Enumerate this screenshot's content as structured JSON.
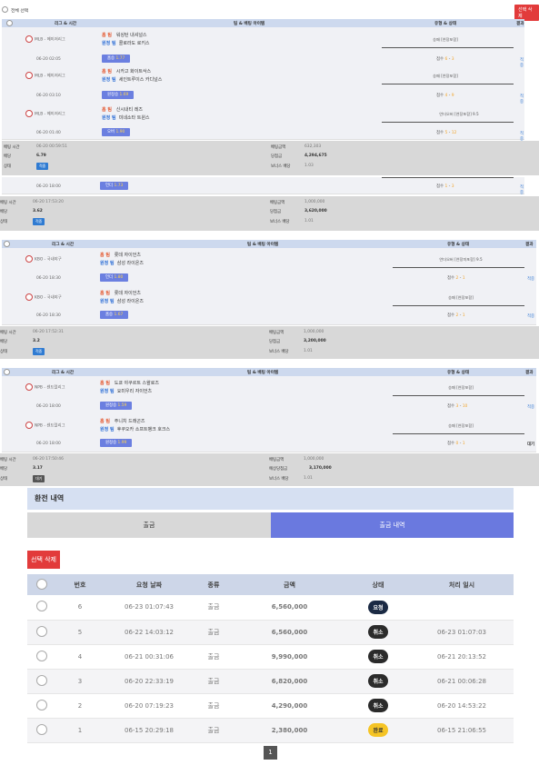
{
  "top": {
    "select_all": "전체 선택",
    "delete_selected": "선택 삭제"
  },
  "bet_header": {
    "league_time": "리그 & 시간",
    "team_bet": "팀 & 배팅 아이템",
    "type_state": "유형 & 상태",
    "result": "결과"
  },
  "summary_labels": {
    "bet_time": "배팅 시간",
    "odds": "배당",
    "state": "상태",
    "bet_amount": "배팅금액",
    "win_amount": "당첨금",
    "bonus_odds": "보너스 배당",
    "expected_win": "예상당첨금"
  },
  "team_tags": {
    "home": "홈 팀",
    "away": "원정 팀"
  },
  "bets": [
    {
      "matches": [
        {
          "league": "MLB - 메이저리그",
          "time": "06-20 02:05",
          "home": "워싱턴 내셔널스",
          "away": "콜로라도 로키스",
          "pick": "홈승",
          "odds": "1.77",
          "type": "승패 [연장포함]",
          "score_label": "점수",
          "score_home": "6",
          "score_away": "3",
          "result": "적중"
        },
        {
          "league": "MLB - 메이저리그",
          "time": "06-20 03:10",
          "home": "시카고 화이트삭스",
          "away": "세인트루이스 카디널스",
          "pick": "원정승",
          "odds": "1.69",
          "type": "승패 [연장포함]",
          "score_label": "점수",
          "score_home": "4",
          "score_away": "9",
          "result": "적중"
        },
        {
          "league": "MLB - 메이저리그",
          "time": "06-20 01:40",
          "home": "신시내티 레즈",
          "away": "미네소타 트윈스",
          "pick": "오버",
          "odds": "1.90",
          "type": "언더오버 [연장포함] 9.5",
          "score_label": "점수",
          "score_home": "5",
          "score_away": "12",
          "result": "적중"
        }
      ],
      "bet_time": "06-20 00:59:51",
      "odds": "6.79",
      "state": "적중",
      "bet_amount": "632,303",
      "win_amount": "4,294,675",
      "bonus_odds": "1.03"
    },
    {
      "matches": [
        {
          "league": "",
          "time": "06-20 18:00",
          "home": "",
          "away": "",
          "pick": "언더",
          "odds": "1.73",
          "type": "",
          "score_label": "점수",
          "score_home": "1",
          "score_away": "3",
          "result": "적중"
        }
      ],
      "bet_time": "06-20 17:53:20",
      "odds": "3.62",
      "state": "적중",
      "bet_amount": "1,000,000",
      "win_amount": "3,620,000",
      "bonus_odds": "1.01"
    },
    {
      "matches": [
        {
          "league": "KBO - 국내야구",
          "time": "06-20 18:30",
          "home": "롯데 자이언츠",
          "away": "삼성 라이온즈",
          "pick": "언더",
          "odds": "1.80",
          "type": "언더오버 [연장미포함] 9.5",
          "score_label": "점수",
          "score_home": "2",
          "score_away": "1",
          "result": "적중"
        },
        {
          "league": "KBO - 국내야구",
          "time": "06-20 18:30",
          "home": "롯데 자이언츠",
          "away": "삼성 라이온즈",
          "pick": "홈승",
          "odds": "1.67",
          "type": "승패 [연장포함]",
          "score_label": "점수",
          "score_home": "2",
          "score_away": "1",
          "result": "적중"
        }
      ],
      "bet_time": "06-20 17:52:31",
      "odds": "3.2",
      "state": "적중",
      "bet_amount": "1,000,000",
      "win_amount": "3,200,000",
      "bonus_odds": "1.01"
    },
    {
      "matches": [
        {
          "league": "NPB - 센트럴리그",
          "time": "06-20 18:00",
          "home": "도쿄 야쿠르트 스왈로즈",
          "away": "요미우리 자이언츠",
          "pick": "원정승",
          "odds": "1.59",
          "type": "승패 [연장포함]",
          "score_label": "점수",
          "score_home": "3",
          "score_away": "10",
          "result": "적중"
        },
        {
          "league": "NPB - 센트럴리그",
          "time": "06-20 18:00",
          "home": "주니치 드래곤즈",
          "away": "후쿠오카 소프트뱅크 호크스",
          "pick": "원정승",
          "odds": "1.99",
          "type": "승패 [연장포함]",
          "score_label": "점수",
          "score_home": "0",
          "score_away": "1",
          "result": "대기"
        }
      ],
      "bet_time": "06-20 17:50:46",
      "odds": "3.17",
      "state": "대기",
      "bet_amount": "1,000,000",
      "win_amount": "3,170,000",
      "bonus_odds": "1.01"
    }
  ],
  "history": {
    "title": "환전 내역",
    "tab_deposit": "출금",
    "tab_withdraw": "출금 내역",
    "delete_selected": "선택 삭제",
    "columns": [
      "번호",
      "요청 날짜",
      "종류",
      "금액",
      "상태",
      "처리 일시"
    ],
    "rows": [
      {
        "no": "6",
        "date": "06-23 01:07:43",
        "kind": "출금",
        "amount": "6,560,000",
        "status": "요청",
        "status_color": "#1b2a44",
        "processed": ""
      },
      {
        "no": "5",
        "date": "06-22 14:03:12",
        "kind": "출금",
        "amount": "6,560,000",
        "status": "취소",
        "status_color": "#2b2b2b",
        "processed": "06-23 01:07:03"
      },
      {
        "no": "4",
        "date": "06-21 00:31:06",
        "kind": "출금",
        "amount": "9,990,000",
        "status": "취소",
        "status_color": "#2b2b2b",
        "processed": "06-21 20:13:52"
      },
      {
        "no": "3",
        "date": "06-20 22:33:19",
        "kind": "출금",
        "amount": "6,820,000",
        "status": "취소",
        "status_color": "#2b2b2b",
        "processed": "06-21 00:06:28"
      },
      {
        "no": "2",
        "date": "06-20 07:19:23",
        "kind": "출금",
        "amount": "4,290,000",
        "status": "취소",
        "status_color": "#2b2b2b",
        "processed": "06-20 14:53:22"
      },
      {
        "no": "1",
        "date": "06-15 20:29:18",
        "kind": "출금",
        "amount": "2,380,000",
        "status": "완료",
        "status_color": "#f5c425",
        "processed": "06-15 21:06:55"
      }
    ],
    "page": "1"
  }
}
